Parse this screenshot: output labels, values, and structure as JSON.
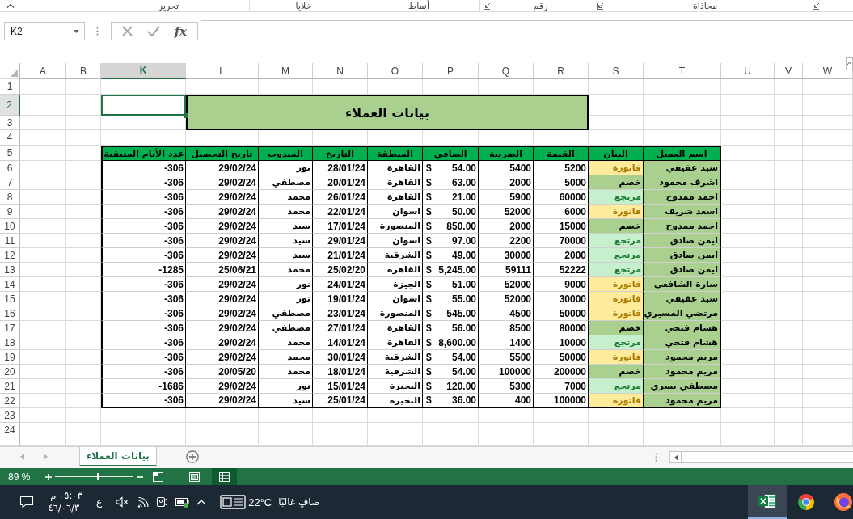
{
  "ribbon": {
    "groups": [
      {
        "launcher": true
      },
      {
        "label": "محاذاة",
        "launcher": true
      },
      {
        "label": "رقم",
        "launcher": true
      },
      {
        "label": "أنماط",
        "launcher": false
      },
      {
        "label": "خلايا",
        "launcher": false
      },
      {
        "label": "تحرير",
        "launcher": false
      }
    ]
  },
  "formula_bar": {
    "name_box": "K2",
    "cancel": {
      "disabled": true
    },
    "enter": {
      "disabled": true
    },
    "function_button": "fx"
  },
  "sheet": {
    "columns": [
      {
        "label": "W",
        "selected": false
      },
      {
        "label": "V",
        "selected": false
      },
      {
        "label": "U",
        "selected": false
      },
      {
        "label": "T",
        "selected": false
      },
      {
        "label": "S",
        "selected": false
      },
      {
        "label": "R",
        "selected": false
      },
      {
        "label": "Q",
        "selected": false
      },
      {
        "label": "P",
        "selected": false
      },
      {
        "label": "O",
        "selected": false
      },
      {
        "label": "N",
        "selected": false
      },
      {
        "label": "M",
        "selected": false
      },
      {
        "label": "L",
        "selected": false
      },
      {
        "label": "K",
        "selected": true
      },
      {
        "label": "B",
        "selected": false
      },
      {
        "label": "A",
        "selected": false
      }
    ],
    "rows": [
      {
        "label": "1",
        "selected": false
      },
      {
        "label": "2",
        "selected": true
      },
      {
        "label": "3",
        "selected": false
      },
      {
        "label": "4",
        "selected": false
      },
      {
        "label": "5",
        "selected": false
      },
      {
        "label": "6",
        "selected": false
      },
      {
        "label": "7",
        "selected": false
      },
      {
        "label": "8",
        "selected": false
      },
      {
        "label": "9",
        "selected": false
      },
      {
        "label": "10",
        "selected": false
      },
      {
        "label": "11",
        "selected": false
      },
      {
        "label": "12",
        "selected": false
      },
      {
        "label": "13",
        "selected": false
      },
      {
        "label": "14",
        "selected": false
      },
      {
        "label": "15",
        "selected": false
      },
      {
        "label": "16",
        "selected": false
      },
      {
        "label": "17",
        "selected": false
      },
      {
        "label": "18",
        "selected": false
      },
      {
        "label": "19",
        "selected": false
      },
      {
        "label": "20",
        "selected": false
      },
      {
        "label": "21",
        "selected": false
      },
      {
        "label": "22",
        "selected": false
      },
      {
        "label": "23",
        "selected": false
      },
      {
        "label": "24",
        "selected": false
      }
    ],
    "title": "بيانات العملاء",
    "table": {
      "headers": [
        "اسم العميل",
        "البيان",
        "القيمة",
        "الضريبة",
        "الصافي",
        "المنطقة",
        "التاريخ",
        "المندوب",
        "تاريخ التحصيل",
        "عدد الأيام المتبقية"
      ],
      "rows": [
        {
          "customer": "سيد عفيفي",
          "statement": {
            "text": "فاتورة",
            "kind": "invoice"
          },
          "value": "5200",
          "tax": "5400",
          "net": {
            "currency": "$",
            "amount": "54.00"
          },
          "region": "القاهرة",
          "date": "28/01/24",
          "representative": "نور",
          "collection_date": "29/02/24",
          "days_remaining": "-306"
        },
        {
          "customer": "اشرف محمود",
          "statement": {
            "text": "خصم",
            "kind": "discount"
          },
          "value": "5000",
          "tax": "2000",
          "net": {
            "currency": "$",
            "amount": "63.00"
          },
          "region": "القاهرة",
          "date": "20/01/24",
          "representative": "مصطفي",
          "collection_date": "29/02/24",
          "days_remaining": "-306"
        },
        {
          "customer": "احمد ممدوح",
          "statement": {
            "text": "مرتجع",
            "kind": "return"
          },
          "value": "60000",
          "tax": "5900",
          "net": {
            "currency": "$",
            "amount": "21.00"
          },
          "region": "القاهرة",
          "date": "26/01/24",
          "representative": "محمد",
          "collection_date": "29/02/24",
          "days_remaining": "-306"
        },
        {
          "customer": "اسعد شريف",
          "statement": {
            "text": "فاتورة",
            "kind": "invoice"
          },
          "value": "6000",
          "tax": "52000",
          "net": {
            "currency": "$",
            "amount": "50.00"
          },
          "region": "اسوان",
          "date": "22/01/24",
          "representative": "محمد",
          "collection_date": "29/02/24",
          "days_remaining": "-306"
        },
        {
          "customer": "احمد ممدوح",
          "statement": {
            "text": "خصم",
            "kind": "discount"
          },
          "value": "15000",
          "tax": "2000",
          "net": {
            "currency": "$",
            "amount": "850.00"
          },
          "region": "المنصورة",
          "date": "17/01/24",
          "representative": "سيد",
          "collection_date": "29/02/24",
          "days_remaining": "-306"
        },
        {
          "customer": "ايمن صادق",
          "statement": {
            "text": "مرتجع",
            "kind": "return"
          },
          "value": "70000",
          "tax": "2200",
          "net": {
            "currency": "$",
            "amount": "97.00"
          },
          "region": "اسوان",
          "date": "29/01/24",
          "representative": "سيد",
          "collection_date": "29/02/24",
          "days_remaining": "-306"
        },
        {
          "customer": "ايمن صادق",
          "statement": {
            "text": "مرتجع",
            "kind": "return"
          },
          "value": "2000",
          "tax": "30000",
          "net": {
            "currency": "$",
            "amount": "49.00"
          },
          "region": "الشرقية",
          "date": "21/01/24",
          "representative": "سيد",
          "collection_date": "29/02/24",
          "days_remaining": "-306"
        },
        {
          "customer": "ايمن صادق",
          "statement": {
            "text": "مرتجع",
            "kind": "return"
          },
          "value": "52222",
          "tax": "59111",
          "net": {
            "currency": "$",
            "amount": "5,245.00"
          },
          "region": "القاهرة",
          "date": "25/02/20",
          "representative": "محمد",
          "collection_date": "25/06/21",
          "days_remaining": "-1285"
        },
        {
          "customer": "سارة الشافعي",
          "statement": {
            "text": "فاتورة",
            "kind": "invoice"
          },
          "value": "9000",
          "tax": "52000",
          "net": {
            "currency": "$",
            "amount": "51.00"
          },
          "region": "الجيزة",
          "date": "24/01/24",
          "representative": "نور",
          "collection_date": "29/02/24",
          "days_remaining": "-306"
        },
        {
          "customer": "سيد عفيفي",
          "statement": {
            "text": "فاتورة",
            "kind": "invoice"
          },
          "value": "30000",
          "tax": "52000",
          "net": {
            "currency": "$",
            "amount": "55.00"
          },
          "region": "اسوان",
          "date": "19/01/24",
          "representative": "نور",
          "collection_date": "29/02/24",
          "days_remaining": "-306"
        },
        {
          "customer": "مرتضي المسيري",
          "statement": {
            "text": "فاتورة",
            "kind": "invoice"
          },
          "value": "50000",
          "tax": "4500",
          "net": {
            "currency": "$",
            "amount": "545.00"
          },
          "region": "المنصورة",
          "date": "23/01/24",
          "representative": "مصطفي",
          "collection_date": "29/02/24",
          "days_remaining": "-306"
        },
        {
          "customer": "هشام فتحي",
          "statement": {
            "text": "خصم",
            "kind": "discount"
          },
          "value": "80000",
          "tax": "8500",
          "net": {
            "currency": "$",
            "amount": "56.00"
          },
          "region": "القاهرة",
          "date": "27/01/24",
          "representative": "مصطفي",
          "collection_date": "29/02/24",
          "days_remaining": "-306"
        },
        {
          "customer": "هشام فتحي",
          "statement": {
            "text": "مرتجع",
            "kind": "return"
          },
          "value": "10000",
          "tax": "1400",
          "net": {
            "currency": "$",
            "amount": "8,600.00"
          },
          "region": "القاهرة",
          "date": "14/01/24",
          "representative": "محمد",
          "collection_date": "29/02/24",
          "days_remaining": "-306"
        },
        {
          "customer": "مريم محمود",
          "statement": {
            "text": "فاتورة",
            "kind": "invoice"
          },
          "value": "50000",
          "tax": "5500",
          "net": {
            "currency": "$",
            "amount": "54.00"
          },
          "region": "الشرقية",
          "date": "30/01/24",
          "representative": "محمد",
          "collection_date": "29/02/24",
          "days_remaining": "-306"
        },
        {
          "customer": "مريم محمود",
          "statement": {
            "text": "خصم",
            "kind": "discount"
          },
          "value": "200000",
          "tax": "100000",
          "net": {
            "currency": "$",
            "amount": "54.00"
          },
          "region": "الشرقية",
          "date": "18/01/24",
          "representative": "محمد",
          "collection_date": "20/05/20",
          "days_remaining": "-306"
        },
        {
          "customer": "مصطفي يسري",
          "statement": {
            "text": "مرتجع",
            "kind": "return"
          },
          "value": "7000",
          "tax": "5300",
          "net": {
            "currency": "$",
            "amount": "120.00"
          },
          "region": "البحيرة",
          "date": "15/01/24",
          "representative": "نور",
          "collection_date": "29/02/24",
          "days_remaining": "-1686"
        },
        {
          "customer": "مريم محمود",
          "statement": {
            "text": "فاتورة",
            "kind": "invoice"
          },
          "value": "100000",
          "tax": "400",
          "net": {
            "currency": "$",
            "amount": "36.00"
          },
          "region": "البحيرة",
          "date": "25/01/24",
          "representative": "سيد",
          "collection_date": "29/02/24",
          "days_remaining": "-306"
        }
      ]
    }
  },
  "sheet_tabs": {
    "tabs": [
      {
        "label": "بيانات العملاء",
        "selected": true
      }
    ]
  },
  "status_bar": {
    "zoom": "89 %",
    "zoom_slider": {
      "level": 0.55
    },
    "views": [
      {
        "kind": "page_break",
        "selected": false
      },
      {
        "kind": "page_layout",
        "selected": false
      },
      {
        "kind": "normal",
        "selected": true
      }
    ]
  },
  "taskbar": {
    "clock": {
      "time": "٠٥:٠٣ م",
      "date": "٤٦/٠٦/٣٠"
    },
    "input_language": "ع",
    "weather": {
      "temperature": "22°C",
      "condition": "صافٍ غالبًا"
    },
    "apps": [
      {
        "kind": "excel",
        "active": true
      },
      {
        "kind": "chrome",
        "active": false
      },
      {
        "kind": "firefox",
        "active": false
      }
    ]
  }
}
